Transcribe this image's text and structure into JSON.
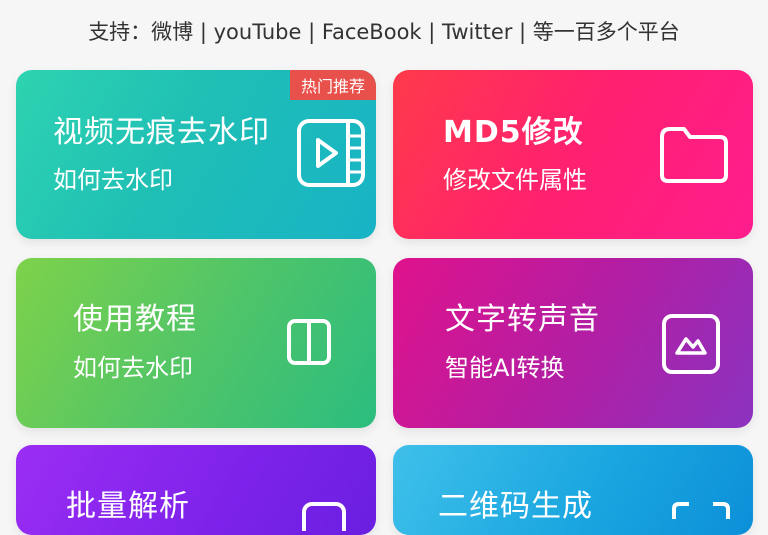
{
  "header": {
    "supported_platforms_text": "支持：微博 | youTube | FaceBook | Twitter | 等一百多个平台"
  },
  "cards": [
    {
      "title": "视频无痕去水印",
      "subtitle": "如何去水印",
      "badge": "热门推荐",
      "icon": "video-play-icon",
      "color": "#1fbfb5"
    },
    {
      "title": "MD5修改",
      "subtitle": "修改文件属性",
      "icon": "folder-icon",
      "color": "#ff2a6a"
    },
    {
      "title": "使用教程",
      "subtitle": "如何去水印",
      "icon": "book-icon",
      "color": "#57c562"
    },
    {
      "title": "文字转声音",
      "subtitle": "智能AI转换",
      "icon": "image-icon",
      "color": "#b01fa5"
    },
    {
      "title": "批量解析",
      "icon": "batch-icon",
      "color": "#7d22ea"
    },
    {
      "title": "二维码生成",
      "icon": "qrcode-icon",
      "color": "#1aa6e0"
    }
  ]
}
